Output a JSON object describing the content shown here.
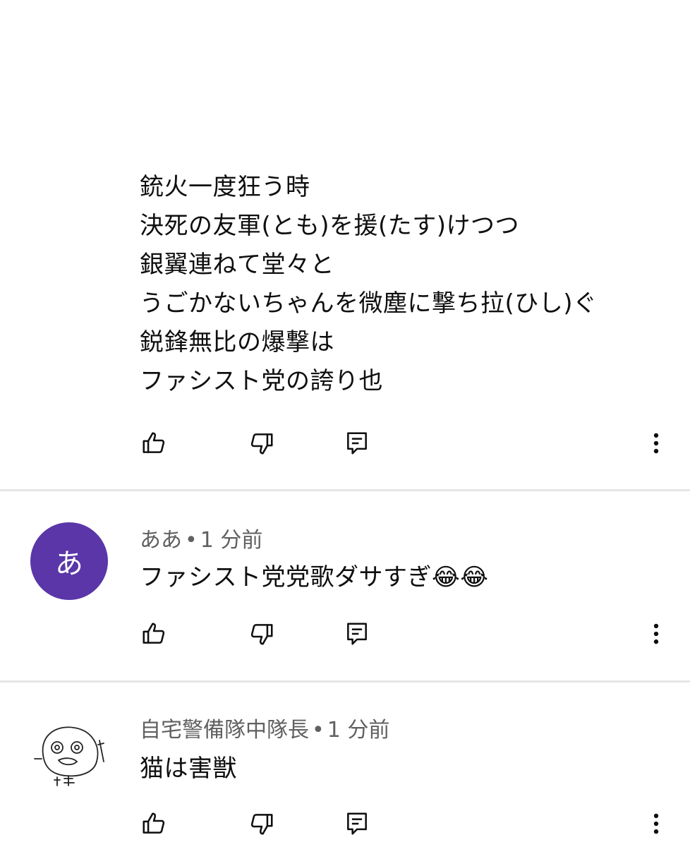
{
  "comments": [
    {
      "lines": [
        "銃火一度狂う時",
        "決死の友軍(とも)を援(たす)けつつ",
        "銀翼連ねて堂々と",
        "うごかないちゃんを微塵に撃ち拉(ひし)ぐ",
        "鋭鋒無比の爆撃は",
        "ファシスト党の誇り也"
      ]
    },
    {
      "author": "ああ",
      "time": "1 分前",
      "avatar_letter": "あ",
      "avatar_color": "#5a36a8",
      "text": "ファシスト党党歌ダサすぎ😂😂"
    },
    {
      "author": "自宅警備隊中隊長",
      "time": "1 分前",
      "avatar_icon": "hand-drawn-face-avatar",
      "text": "猫は害獣"
    }
  ],
  "separator": "•",
  "icons": {
    "like": "thumbs-up-icon",
    "dislike": "thumbs-down-icon",
    "reply": "reply-comment-icon",
    "more": "more-vertical-icon"
  },
  "colors": {
    "meta_text": "#606060",
    "divider": "#e6e6e6"
  }
}
